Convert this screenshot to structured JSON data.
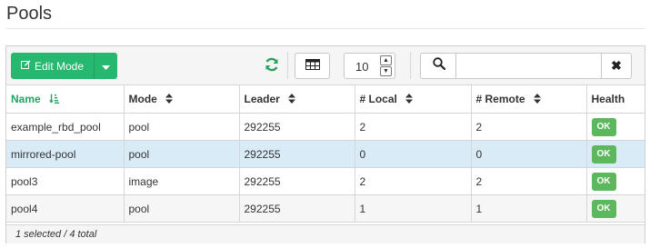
{
  "page": {
    "title": "Pools"
  },
  "toolbar": {
    "edit_mode_label": "Edit Mode",
    "refresh_icon": "refresh-icon",
    "columns_icon": "table-icon",
    "page_size": "10",
    "search_icon": "search-icon",
    "search_value": "",
    "clear_label": "✖"
  },
  "table": {
    "columns": [
      {
        "label": "Name",
        "sort": "↓≡",
        "active": true
      },
      {
        "label": "Mode",
        "sort": "◆"
      },
      {
        "label": "Leader",
        "sort": "◆"
      },
      {
        "label": "# Local",
        "sort": "◆"
      },
      {
        "label": "# Remote",
        "sort": "◆"
      },
      {
        "label": "Health",
        "sort": ""
      }
    ],
    "rows": [
      {
        "name": "example_rbd_pool",
        "mode": "pool",
        "leader": "292255",
        "local": "2",
        "remote": "2",
        "health": "OK"
      },
      {
        "name": "mirrored-pool",
        "mode": "pool",
        "leader": "292255",
        "local": "0",
        "remote": "0",
        "health": "OK"
      },
      {
        "name": "pool3",
        "mode": "image",
        "leader": "292255",
        "local": "2",
        "remote": "2",
        "health": "OK"
      },
      {
        "name": "pool4",
        "mode": "pool",
        "leader": "292255",
        "local": "1",
        "remote": "1",
        "health": "OK"
      }
    ]
  },
  "footer": {
    "summary": "1 selected / 4 total"
  },
  "colors": {
    "primary": "#26b86f",
    "health_ok": "#5cb85c",
    "selected_row": "#d9ebf6",
    "active_sort": "#1fa562"
  }
}
